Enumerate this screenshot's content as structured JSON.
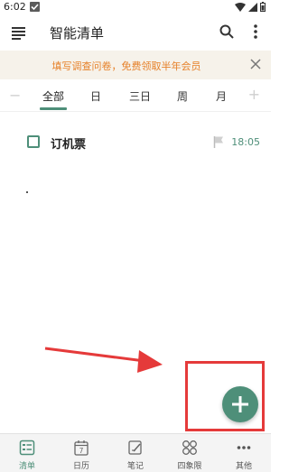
{
  "status_bar": {
    "time": "6:02"
  },
  "app_bar": {
    "title": "智能清单"
  },
  "banner": {
    "text": "填写调查问卷，免费领取半年会员"
  },
  "period_tabs": {
    "minus": "−",
    "plus": "+",
    "items": [
      {
        "label": "全部",
        "active": true
      },
      {
        "label": "日",
        "active": false
      },
      {
        "label": "三日",
        "active": false
      },
      {
        "label": "周",
        "active": false
      },
      {
        "label": "月",
        "active": false
      }
    ]
  },
  "tasks": [
    {
      "title": "订机票",
      "time": "18:05"
    }
  ],
  "bottom_nav": {
    "items": [
      {
        "label": "清单",
        "icon": "checklist-icon",
        "active": true
      },
      {
        "label": "日历",
        "icon": "calendar-icon",
        "active": false
      },
      {
        "label": "笔记",
        "icon": "notes-icon",
        "active": false
      },
      {
        "label": "四象限",
        "icon": "quadrant-icon",
        "active": false
      },
      {
        "label": "其他",
        "icon": "more-horizontal-icon",
        "active": false
      }
    ],
    "calendar_day": "7"
  },
  "colors": {
    "accent": "#4e8f79",
    "banner_text": "#e6812a",
    "banner_bg": "#f6f2ea",
    "annotation_red": "#e53a3a"
  }
}
